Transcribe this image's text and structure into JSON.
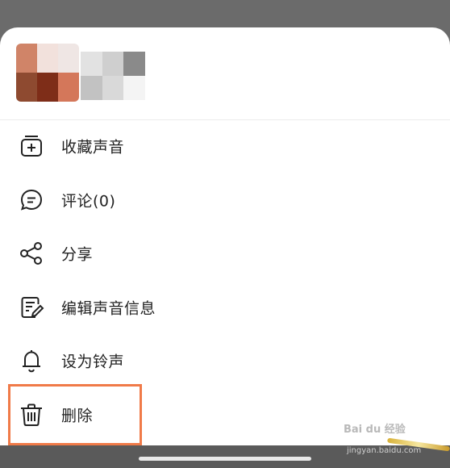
{
  "menu": {
    "items": [
      {
        "label": "收藏声音",
        "icon": "add-favorite-icon"
      },
      {
        "label": "评论(0)",
        "icon": "comment-icon"
      },
      {
        "label": "分享",
        "icon": "share-icon"
      },
      {
        "label": "编辑声音信息",
        "icon": "edit-info-icon"
      },
      {
        "label": "设为铃声",
        "icon": "bell-icon"
      },
      {
        "label": "删除",
        "icon": "trash-icon"
      }
    ]
  },
  "colors": {
    "highlight": "#f07a48",
    "backdrop": "#6b6b6b",
    "sheet": "#ffffff"
  },
  "watermark": {
    "brand": "Bai du 经验",
    "url": "jingyan.baidu.com"
  }
}
